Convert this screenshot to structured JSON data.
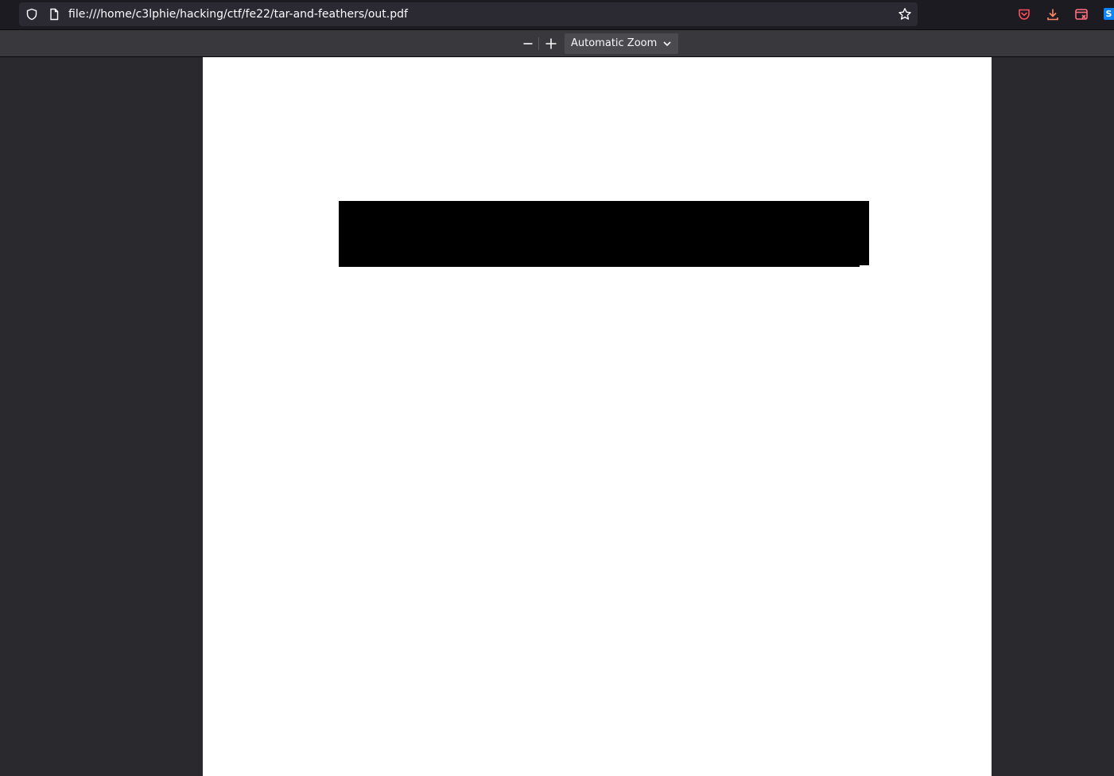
{
  "browser": {
    "url": "file:///home/c3lphie/hacking/ctf/fe22/tar-and-feathers/out.pdf",
    "icons": {
      "shield": "shield-icon",
      "page": "page-icon",
      "star": "star-icon",
      "pocket": "pocket-icon",
      "download": "download-icon",
      "extension": "screenshot-icon",
      "ext_badge": "S"
    }
  },
  "pdf_toolbar": {
    "zoom_label": "Automatic Zoom"
  },
  "colors": {
    "accent": "#0a84ff",
    "pocket": "#ff4f5e"
  }
}
